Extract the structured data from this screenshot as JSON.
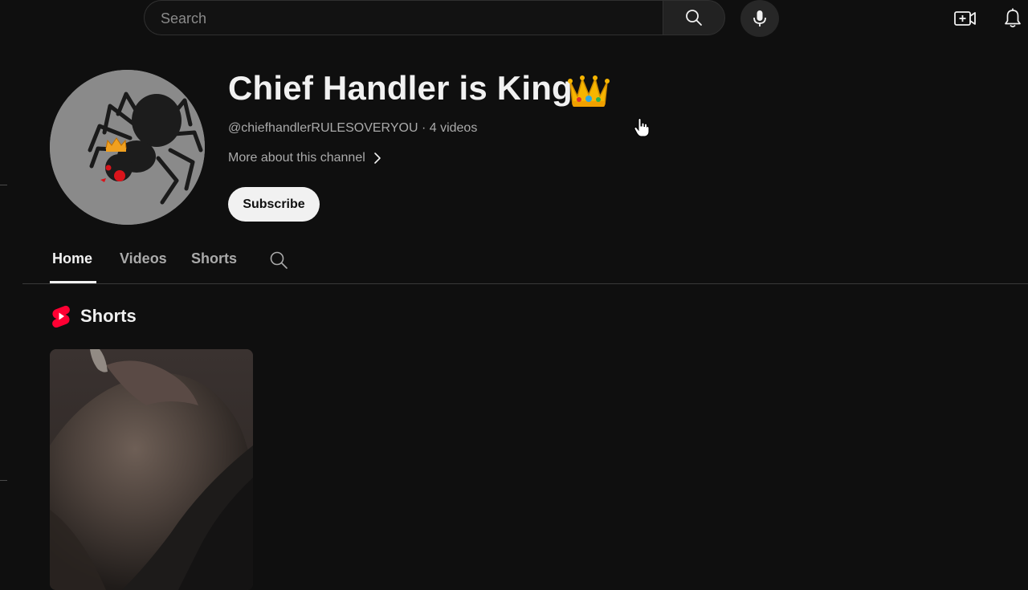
{
  "search": {
    "placeholder": "Search"
  },
  "channel": {
    "name": "Chief Handler is King",
    "handle": "@chiefhandlerRULESOVERYOU",
    "video_count": "4 videos",
    "separator": "·",
    "more_about": "More about this channel",
    "subscribe_label": "Subscribe"
  },
  "tabs": [
    {
      "label": "Home",
      "active": true
    },
    {
      "label": "Videos",
      "active": false
    },
    {
      "label": "Shorts",
      "active": false
    }
  ],
  "shorts_section": {
    "title": "Shorts"
  },
  "icons": {
    "search": "search-icon",
    "mic": "microphone-icon",
    "create": "create-video-icon",
    "notifications": "bell-icon",
    "shorts_logo": "shorts-logo-icon",
    "chevron": "chevron-right-icon",
    "crown": "crown-emoji-icon"
  },
  "colors": {
    "background": "#0f0f0f",
    "text": "#f1f1f1",
    "secondary_text": "#aaaaaa",
    "shorts_red": "#ff0033",
    "subscribe_bg": "#f1f1f1"
  }
}
